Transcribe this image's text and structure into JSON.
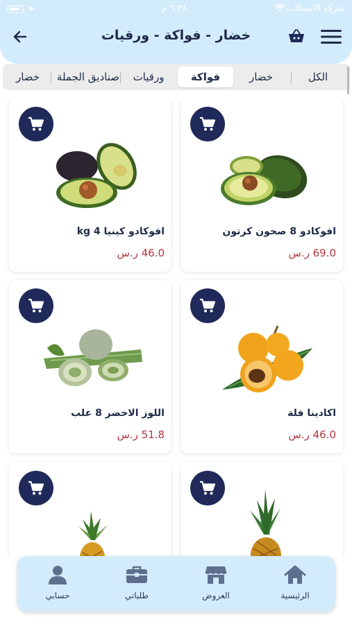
{
  "status_bar": {
    "carrier": "شركة الاتصالات",
    "time": "٦:٣٨ م"
  },
  "header": {
    "title": "خضار - فواكة - ورقيات"
  },
  "tabs": [
    {
      "label": "الكل",
      "active": false
    },
    {
      "label": "خضار",
      "active": false
    },
    {
      "label": "فواكة",
      "active": true
    },
    {
      "label": "ورقيات",
      "active": false
    },
    {
      "label": "صناديق الجملة",
      "active": false
    },
    {
      "label": "خضار",
      "active": false
    }
  ],
  "products": [
    {
      "name": "افوكادو 8 صحون كرتون",
      "price": "69.0 ر.س",
      "image": "avocado-whole-and-half"
    },
    {
      "name": "افوكادو كينيا 4 kg",
      "price": "46.0 ر.س",
      "image": "avocado-halves"
    },
    {
      "name": "اكادينا فلة",
      "price": "46.0 ر.س",
      "image": "loquat"
    },
    {
      "name": "اللوز الاخضر 8 علب",
      "price": "51.8 ر.س",
      "image": "green-almond"
    },
    {
      "name": "",
      "price": "",
      "image": "pineapple"
    },
    {
      "name": "",
      "price": "",
      "image": "pineapple-small"
    }
  ],
  "bottom_nav": [
    {
      "label": "الرئيسية",
      "icon": "home-icon"
    },
    {
      "label": "العروض",
      "icon": "store-icon"
    },
    {
      "label": "طلباتي",
      "icon": "briefcase-icon"
    },
    {
      "label": "حسابي",
      "icon": "user-icon"
    }
  ],
  "colors": {
    "header_bg": "#d3ecfc",
    "primary_dark": "#1f2a5a",
    "price_red": "#b3353f",
    "title_text": "#1f2a48"
  }
}
